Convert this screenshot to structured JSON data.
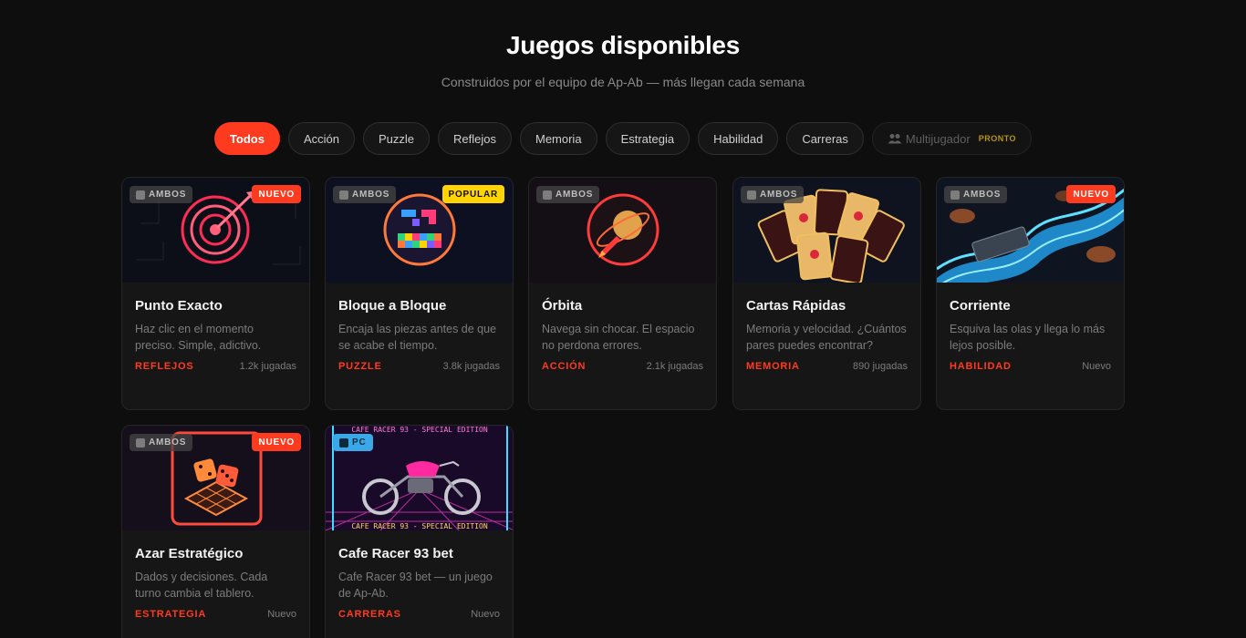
{
  "header": {
    "title": "Juegos disponibles",
    "subtitle": "Construidos por el equipo de Ap-Ab — más llegan cada semana"
  },
  "filters": [
    {
      "label": "Todos",
      "active": true
    },
    {
      "label": "Acción"
    },
    {
      "label": "Puzzle"
    },
    {
      "label": "Reflejos"
    },
    {
      "label": "Memoria"
    },
    {
      "label": "Estrategia"
    },
    {
      "label": "Habilidad"
    },
    {
      "label": "Carreras"
    }
  ],
  "multiplayer": {
    "label": "Multijugador",
    "soon": "PRONTO",
    "icon": "people-icon"
  },
  "accent": "#ff3b1f",
  "games": [
    {
      "title": "Punto Exacto",
      "desc": "Haz clic en el momento preciso. Simple, adictivo.",
      "category": "REFLEJOS",
      "plays": "1.2k jugadas",
      "platform": "AMBOS",
      "badge": "NUEVO",
      "image": "target-icon"
    },
    {
      "title": "Bloque a Bloque",
      "desc": "Encaja las piezas antes de que se acabe el tiempo.",
      "category": "PUZZLE",
      "plays": "3.8k jugadas",
      "platform": "AMBOS",
      "badge": "POPULAR",
      "image": "blocks-icon"
    },
    {
      "title": "Órbita",
      "desc": "Navega sin chocar. El espacio no perdona errores.",
      "category": "ACCIÓN",
      "plays": "2.1k jugadas",
      "platform": "AMBOS",
      "badge": "",
      "image": "rocket-icon"
    },
    {
      "title": "Cartas Rápidas",
      "desc": "Memoria y velocidad. ¿Cuántos pares puedes encontrar?",
      "category": "MEMORIA",
      "plays": "890 jugadas",
      "platform": "AMBOS",
      "badge": "",
      "image": "cards-icon"
    },
    {
      "title": "Corriente",
      "desc": "Esquiva las olas y llega lo más lejos posible.",
      "category": "HABILIDAD",
      "plays": "Nuevo",
      "platform": "AMBOS",
      "badge": "NUEVO",
      "image": "river-icon"
    },
    {
      "title": "Azar Estratégico",
      "desc": "Dados y decisiones. Cada turno cambia el tablero.",
      "category": "ESTRATEGIA",
      "plays": "Nuevo",
      "platform": "AMBOS",
      "badge": "NUEVO",
      "image": "dice-icon"
    },
    {
      "title": "Cafe Racer 93 bet",
      "desc": "Cafe Racer 93 bet — un juego de Ap-Ab.",
      "category": "CARRERAS",
      "plays": "Nuevo",
      "platform": "PC",
      "badge": "",
      "image": "motorcycle-icon",
      "banner_top": "CAFE RACER 93 - SPECIAL EDITION",
      "banner_bottom": "CAFE RACER 93 - SPECIAL EDITION"
    }
  ]
}
